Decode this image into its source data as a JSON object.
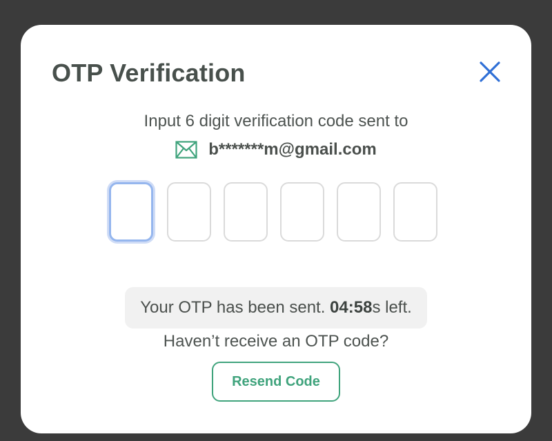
{
  "modal": {
    "title": "OTP Verification",
    "close_icon": "close-icon"
  },
  "instruction": {
    "text": "Input 6 digit verification code sent to",
    "email_icon": "mail-icon",
    "email": "b*******m@gmail.com"
  },
  "otp": {
    "digits": [
      "",
      "",
      "",
      "",
      "",
      ""
    ],
    "focused_index": 0
  },
  "status": {
    "prefix": "Your OTP has been sent. ",
    "time": "04:58",
    "suffix": "s left."
  },
  "resend": {
    "prompt": "Haven’t receive an OTP code?",
    "button_label": "Resend Code"
  },
  "colors": {
    "accent_green": "#3fa37c",
    "close_blue": "#2f6fd6",
    "focus_blue": "#95b6ee",
    "title_text": "#48504c",
    "backdrop": "#3b3b3b"
  }
}
